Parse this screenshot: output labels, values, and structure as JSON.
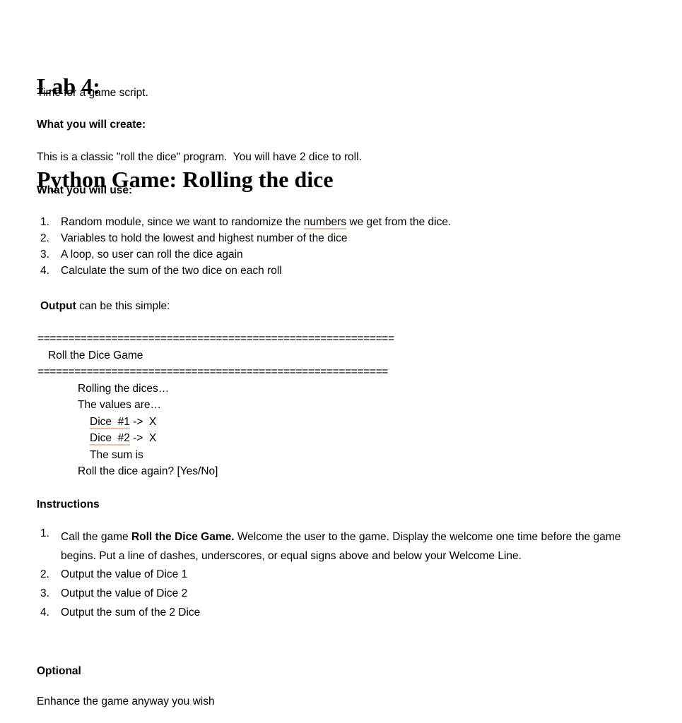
{
  "document": {
    "title_lines": [
      "Lab 4:",
      "Python Game: Rolling the dice"
    ],
    "intro": "Time for a game script.",
    "sections": {
      "what_create_heading": "What you will create:",
      "what_create_body": "This is a classic \"roll the dice\" program.  You will have 2 dice to roll.",
      "what_use_heading": "What you will use:",
      "output_label_bold": "Output",
      "output_label_rest": " can be this simple:",
      "instructions_heading": "Instructions",
      "optional_heading": "Optional",
      "optional_body": "Enhance the game anyway you wish"
    },
    "what_use_list": [
      {
        "num": "1.",
        "pre": "Random module, since we want to randomize the ",
        "misspelled": "numbers",
        "post": " we get from the dice."
      },
      {
        "num": "2.",
        "pre": "Variables to hold the lowest and highest number of the dice",
        "misspelled": "",
        "post": ""
      },
      {
        "num": "3.",
        "pre": "A loop, so user can roll the dice again",
        "misspelled": "",
        "post": ""
      },
      {
        "num": "4.",
        "pre": "Calculate the sum of the two dice on each roll",
        "misspelled": "",
        "post": ""
      }
    ],
    "output_block": {
      "rule_top": "==========================================================",
      "rule_bottom": "=========================================================",
      "title_line": "Roll the Dice Game",
      "line_rolling": "Rolling the dices…",
      "line_values": "The values are…",
      "dice1_label": "Dice  #1",
      "dice1_rest": " ->  X",
      "dice2_label": "Dice  #2",
      "dice2_rest": " ->  X",
      "line_sum": "The sum is",
      "line_again": "Roll the dice again? [Yes/No]"
    },
    "instructions_list": [
      {
        "num": "1.",
        "pre": "Call the game ",
        "bold": "Roll the Dice Game.",
        "post": "  Welcome the user to the game.  Display the welcome one time before the game begins.  Put a line of dashes, underscores, or equal signs above and below your Welcome Line."
      },
      {
        "num": "2.",
        "pre": "Output the value of Dice 1",
        "bold": "",
        "post": ""
      },
      {
        "num": "3.",
        "pre": "Output the value of Dice 2",
        "bold": "",
        "post": ""
      },
      {
        "num": "4.",
        "pre": "Output the sum of the 2 Dice",
        "bold": "",
        "post": ""
      }
    ],
    "colors": {
      "text": "#000000",
      "background": "#ffffff",
      "spellcheck_underline": "#e8bfa0"
    }
  }
}
